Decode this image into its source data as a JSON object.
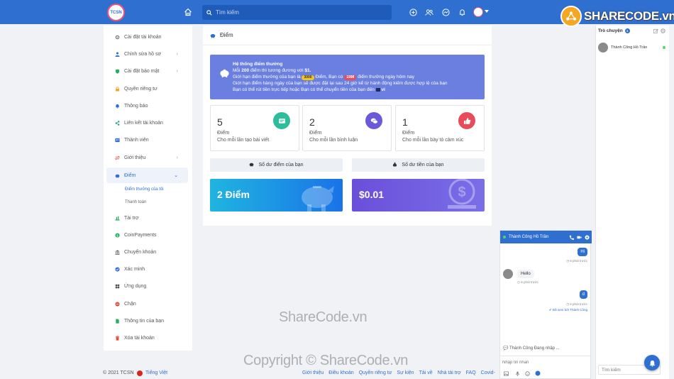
{
  "topbar": {
    "logo_text": "TCSN",
    "search_placeholder": "Tìm kiếm"
  },
  "brand_logo": "SHARECODE.vn",
  "sidebar": {
    "items": [
      {
        "label": "Cài đặt tài khoản",
        "icon": "gear-icon",
        "color": "#777777"
      },
      {
        "label": "Chỉnh sửa hồ sơ",
        "icon": "user-icon",
        "color": "#2f6fd0"
      },
      {
        "label": "Cài đặt bảo mật",
        "icon": "shield-icon",
        "color": "#27ae60"
      },
      {
        "label": "Quyền riêng tư",
        "icon": "lock-icon",
        "color": "#f5a623"
      },
      {
        "label": "Thông báo",
        "icon": "bell-icon",
        "color": "#2f6fd0"
      },
      {
        "label": "Liên kết tài khoản",
        "icon": "share-icon",
        "color": "#16a085"
      },
      {
        "label": "Thành viên",
        "icon": "members-icon",
        "color": "#2f6fd0"
      },
      {
        "label": "Giới thiệu",
        "icon": "exchange-icon",
        "color": "#e74c3c"
      },
      {
        "label": "Điểm",
        "icon": "piggy-bank-icon",
        "color": "#2f6fd0"
      },
      {
        "label": "Tài trợ",
        "icon": "sponsor-icon",
        "color": "#27ae60"
      },
      {
        "label": "CoinPayments",
        "icon": "coin-icon",
        "color": "#27ae60"
      },
      {
        "label": "Chuyển khoản",
        "icon": "bank-icon",
        "color": "#555555"
      },
      {
        "label": "Xác minh",
        "icon": "check-circle-icon",
        "color": "#2f6fd0"
      },
      {
        "label": "Ứng dụng",
        "icon": "apps-icon",
        "color": "#555555"
      },
      {
        "label": "Chặn",
        "icon": "block-icon",
        "color": "#e74c3c"
      },
      {
        "label": "Thông tin của bạn",
        "icon": "file-icon",
        "color": "#27ae60"
      },
      {
        "label": "Xóa tài khoản",
        "icon": "trash-icon",
        "color": "#e74c3c"
      }
    ],
    "sub_items": [
      "Điểm thưởng của tôi",
      "Thanh toán"
    ]
  },
  "main": {
    "title": "Điểm",
    "banner": {
      "heading": "Hệ thống điểm thưởng",
      "line1_a": "Mỗi",
      "line1_b": "200",
      "line1_c": "điểm thì tương đương với",
      "line1_d": "$1.",
      "line2_a": "Giới hạn điểm thưởng của bạn là",
      "line2_b": "3000",
      "line2_c": "Điểm, Bạn có",
      "line2_d": "1998",
      "line2_e": "điểm thưởng ngày hôm nay",
      "line3": "Giới hạn điểm hàng ngày của bạn sẽ được đặt lại sau 24 giờ kể từ hành động kiếm được hợp lệ của bạn",
      "line4": "Bạn có thể rút tiền trực tiếp hoặc Bạn có thể chuyển tiền của bạn đến",
      "line4_end": "ví"
    },
    "cards": [
      {
        "value": "5",
        "unit": "Điểm",
        "desc": "Cho mỗi lần tạo bài viết",
        "icon": "post-icon",
        "color": "#2ebd9b"
      },
      {
        "value": "2",
        "unit": "Điểm",
        "desc": "Cho mỗi lần bình luận",
        "icon": "comment-icon",
        "color": "#6a5ad9"
      },
      {
        "value": "1",
        "unit": "Điểm",
        "desc": "Cho mỗi lần bày tỏ cảm xúc",
        "icon": "like-icon",
        "color": "#e64c5a"
      }
    ],
    "balance_points_label": "Số dư điểm của bạn",
    "balance_money_label": "Số dư tiền của bạn",
    "points_value": "2 Điểm",
    "money_value": "$0.01"
  },
  "chat": {
    "name": "Thành Công Hồ Trần",
    "messages": [
      {
        "side": "right",
        "text": "Hi",
        "time": "6 phút trước"
      },
      {
        "side": "left",
        "text": "Hello",
        "time": "6 phút trước"
      },
      {
        "side": "right",
        "text": "d",
        "time": "6 phút trước"
      }
    ],
    "seen": "Đã xem bởi Thành Công",
    "typing": "Thành Công Đang nhập ...",
    "input_placeholder": "Nhập tin nhắn"
  },
  "right_panel": {
    "title": "Trò chuyện",
    "badge": "1",
    "user": "Thành Công Hồ Trần",
    "search_placeholder": "Tìm kiếm"
  },
  "footer": {
    "copyright": "© 2021 TCSN",
    "language": "Tiếng Việt",
    "links": [
      "Giới thiệu",
      "Điều khoản",
      "Quyền riêng tư",
      "Sự kiện",
      "Tải về",
      "Nhà tài trợ",
      "FAQ",
      "Covid-"
    ]
  },
  "watermarks": [
    "ShareCode.vn",
    "Copyright © ShareCode.vn"
  ]
}
